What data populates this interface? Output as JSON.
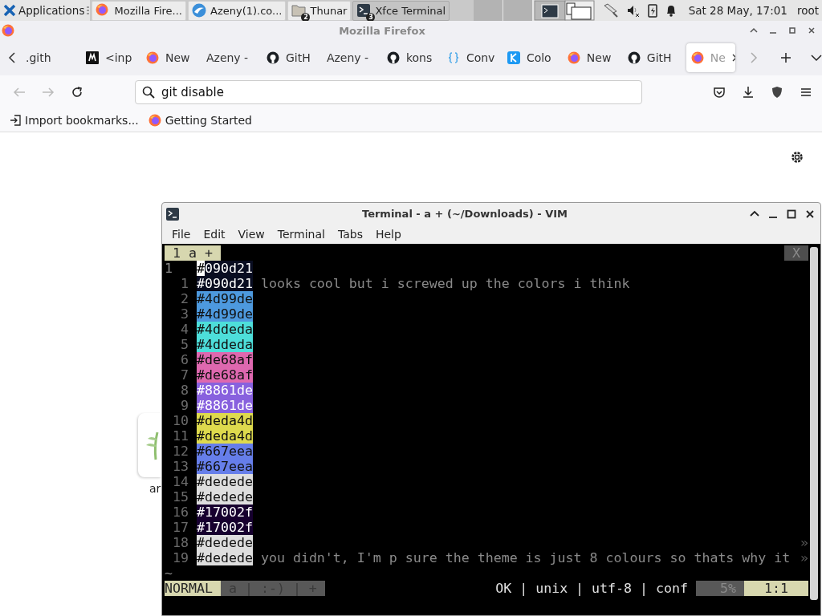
{
  "taskbar": {
    "menu": "Applications",
    "tasks": [
      {
        "label": "Mozilla Fire...",
        "kind": "firefox",
        "selected": false
      },
      {
        "label": "Azeny(1).co...",
        "kind": "globe",
        "selected": false
      },
      {
        "label": "Thunar",
        "kind": "folder",
        "badge": "2",
        "selected": false
      },
      {
        "label": "Xfce Terminal",
        "kind": "terminal",
        "badge": "3",
        "selected": true
      }
    ],
    "clock": "Sat 28 May, 17:01",
    "user": "root"
  },
  "browser": {
    "title": "Mozilla Firefox",
    "tabs": [
      {
        "label": ".gith",
        "selected": false
      },
      {
        "label": "<inp",
        "kind": "m",
        "selected": false
      },
      {
        "label": "New",
        "kind": "firefox",
        "selected": false
      },
      {
        "label": "Azeny -",
        "selected": false
      },
      {
        "label": "GitH",
        "kind": "github",
        "selected": false
      },
      {
        "label": "Azeny -",
        "selected": false
      },
      {
        "label": "kons",
        "kind": "github",
        "selected": false
      },
      {
        "label": "Conv",
        "kind": "braces",
        "selected": false
      },
      {
        "label": "Colo",
        "kind": "k",
        "selected": false
      },
      {
        "label": "New",
        "kind": "firefox",
        "selected": false
      },
      {
        "label": "GitH",
        "kind": "github",
        "selected": false
      },
      {
        "label": "Ne",
        "kind": "firefox",
        "selected": true
      }
    ],
    "address": {
      "value": "git disable"
    },
    "bookmarks": [
      {
        "label": "Import bookmarks...",
        "kind": "import"
      },
      {
        "label": "Getting Started",
        "kind": "firefox"
      }
    ],
    "tile": {
      "label": "ar"
    }
  },
  "terminal": {
    "title": "Terminal - a + (~/Downloads) - VIM",
    "menu": [
      "File",
      "Edit",
      "View",
      "Terminal",
      "Tabs",
      "Help"
    ],
    "tabline": {
      "label": "1 a +",
      "close": "X"
    },
    "lines": [
      {
        "number": "1",
        "current": true,
        "text": "#090d21",
        "color": "#090d21",
        "cursor": true
      },
      {
        "number": "1",
        "current": false,
        "text": "#090d21",
        "color": "#090d21",
        "cursor": false,
        "comment": "looks cool but i screwed up the colors i think"
      },
      {
        "number": "2",
        "current": false,
        "text": "#4d99de",
        "color": "#4d99de",
        "cursor": false
      },
      {
        "number": "3",
        "current": false,
        "text": "#4d99de",
        "color": "#4d99de",
        "cursor": false
      },
      {
        "number": "4",
        "current": false,
        "text": "#4ddeda",
        "color": "#4ddeda",
        "cursor": false
      },
      {
        "number": "5",
        "current": false,
        "text": "#4ddeda",
        "color": "#4ddeda",
        "cursor": false
      },
      {
        "number": "6",
        "current": false,
        "text": "#de68af",
        "color": "#de68af",
        "cursor": false
      },
      {
        "number": "7",
        "current": false,
        "text": "#de68af",
        "color": "#de68af",
        "cursor": false
      },
      {
        "number": "8",
        "current": false,
        "text": "#8861de",
        "color": "#8861de",
        "cursor": false
      },
      {
        "number": "9",
        "current": false,
        "text": "#8861de",
        "color": "#8861de",
        "cursor": false
      },
      {
        "number": "10",
        "current": false,
        "text": "#deda4d",
        "color": "#deda4d",
        "cursor": false
      },
      {
        "number": "11",
        "current": false,
        "text": "#deda4d",
        "color": "#deda4d",
        "cursor": false
      },
      {
        "number": "12",
        "current": false,
        "text": "#667eea",
        "color": "#667eea",
        "cursor": false
      },
      {
        "number": "13",
        "current": false,
        "text": "#667eea",
        "color": "#667eea",
        "cursor": false
      },
      {
        "number": "14",
        "current": false,
        "text": "#dedede",
        "color": "#dedede",
        "cursor": false
      },
      {
        "number": "15",
        "current": false,
        "text": "#dedede",
        "color": "#dedede",
        "cursor": false
      },
      {
        "number": "16",
        "current": false,
        "text": "#17002f",
        "color": "#17002f",
        "cursor": false
      },
      {
        "number": "17",
        "current": false,
        "text": "#17002f",
        "color": "#17002f",
        "cursor": false
      },
      {
        "number": "18",
        "current": false,
        "text": "#dedede",
        "color": "#dedede",
        "cursor": false,
        "wrap": "»"
      },
      {
        "number": "19",
        "current": false,
        "text": "#dedede",
        "color": "#dedede",
        "cursor": false,
        "comment": "you didn't, I'm p sure the theme is just 8 colours so thats why it",
        "wrap": "»"
      }
    ],
    "tildes": [
      "~"
    ],
    "status": {
      "mode": "NORMAL",
      "info": "a | :-) | +",
      "file": "OK | unix | utf-8 | conf",
      "percent": "5%",
      "position": "1:1"
    }
  }
}
